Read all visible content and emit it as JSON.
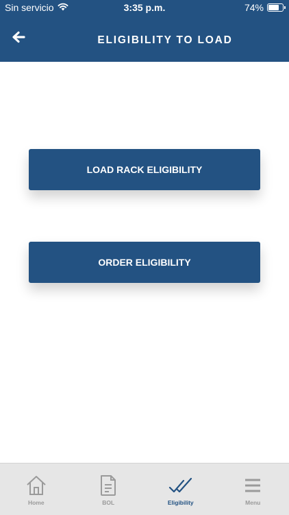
{
  "status_bar": {
    "carrier": "Sin servicio",
    "time": "3:35 p.m.",
    "battery": "74%",
    "battery_level": 0.74
  },
  "header": {
    "title": "ELIGIBILITY TO LOAD",
    "back_icon": "arrow-left-icon"
  },
  "main": {
    "buttons": [
      {
        "label": "LOAD RACK ELIGIBILITY"
      },
      {
        "label": "ORDER ELIGIBILITY"
      }
    ]
  },
  "tab_bar": {
    "tabs": [
      {
        "label": "Home",
        "icon": "home-icon"
      },
      {
        "label": "BOL",
        "icon": "document-icon"
      },
      {
        "label": "Eligibility",
        "icon": "double-check-icon",
        "active": true
      },
      {
        "label": "Menu",
        "icon": "hamburger-menu-icon"
      }
    ]
  },
  "colors": {
    "primary": "#235282",
    "tab_inactive": "#9a9a9a",
    "tab_bar_bg": "#e6e6e6"
  }
}
